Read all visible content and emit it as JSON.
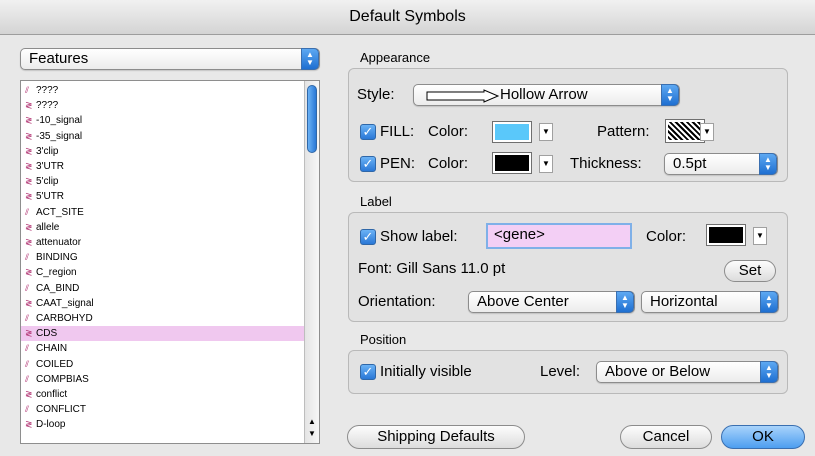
{
  "window": {
    "title": "Default Symbols"
  },
  "features_popup": {
    "value": "Features",
    "arrows": "▲▼"
  },
  "feature_list": {
    "items": [
      {
        "label": "????",
        "icon": "striped-icon"
      },
      {
        "label": "????",
        "icon": "arrow-icon"
      },
      {
        "label": "-10_signal",
        "icon": "arrow-icon"
      },
      {
        "label": "-35_signal",
        "icon": "arrow-icon"
      },
      {
        "label": "3'clip",
        "icon": "arrow-icon"
      },
      {
        "label": "3'UTR",
        "icon": "arrow-icon"
      },
      {
        "label": "5'clip",
        "icon": "arrow-icon"
      },
      {
        "label": "5'UTR",
        "icon": "arrow-icon"
      },
      {
        "label": "ACT_SITE",
        "icon": "striped-icon"
      },
      {
        "label": "allele",
        "icon": "arrow-icon"
      },
      {
        "label": "attenuator",
        "icon": "arrow-icon"
      },
      {
        "label": "BINDING",
        "icon": "striped-icon"
      },
      {
        "label": "C_region",
        "icon": "arrow-icon"
      },
      {
        "label": "CA_BIND",
        "icon": "striped-icon"
      },
      {
        "label": "CAAT_signal",
        "icon": "arrow-icon"
      },
      {
        "label": "CARBOHYD",
        "icon": "striped-icon"
      },
      {
        "label": "CDS",
        "icon": "arrow-icon"
      },
      {
        "label": "CHAIN",
        "icon": "striped-icon"
      },
      {
        "label": "COILED",
        "icon": "striped-icon"
      },
      {
        "label": "COMPBIAS",
        "icon": "striped-icon"
      },
      {
        "label": "conflict",
        "icon": "arrow-icon"
      },
      {
        "label": "CONFLICT",
        "icon": "striped-icon"
      },
      {
        "label": "D-loop",
        "icon": "arrow-icon"
      }
    ],
    "selected_index": 16
  },
  "appearance": {
    "title": "Appearance",
    "style_label": "Style:",
    "style_value": "Hollow Arrow",
    "fill_label": "FILL:",
    "fill_color_label": "Color:",
    "fill_color": "#5ac8fa",
    "pattern_label": "Pattern:",
    "pen_label": "PEN:",
    "pen_color_label": "Color:",
    "pen_color": "#000000",
    "thickness_label": "Thickness:",
    "thickness_value": "0.5pt"
  },
  "label_group": {
    "title": "Label",
    "show_label": "Show label:",
    "label_value": "<gene>",
    "color_label": "Color:",
    "label_color": "#000000",
    "font_text": "Font: Gill Sans 11.0 pt",
    "set_button": "Set",
    "orientation_label": "Orientation:",
    "orientation_value": "Above Center",
    "direction_value": "Horizontal"
  },
  "position_group": {
    "title": "Position",
    "initially_visible": "Initially visible",
    "level_label": "Level:",
    "level_value": "Above or Below"
  },
  "buttons": {
    "shipping_defaults": "Shipping Defaults",
    "cancel": "Cancel",
    "ok": "OK"
  },
  "glyphs": {
    "check": "✓",
    "down": "▼",
    "up": "▲",
    "stripe": "⫽",
    "arrow": "≷"
  },
  "colors": {
    "selection": "#f0c8ef",
    "accent": "#2a78d6"
  }
}
